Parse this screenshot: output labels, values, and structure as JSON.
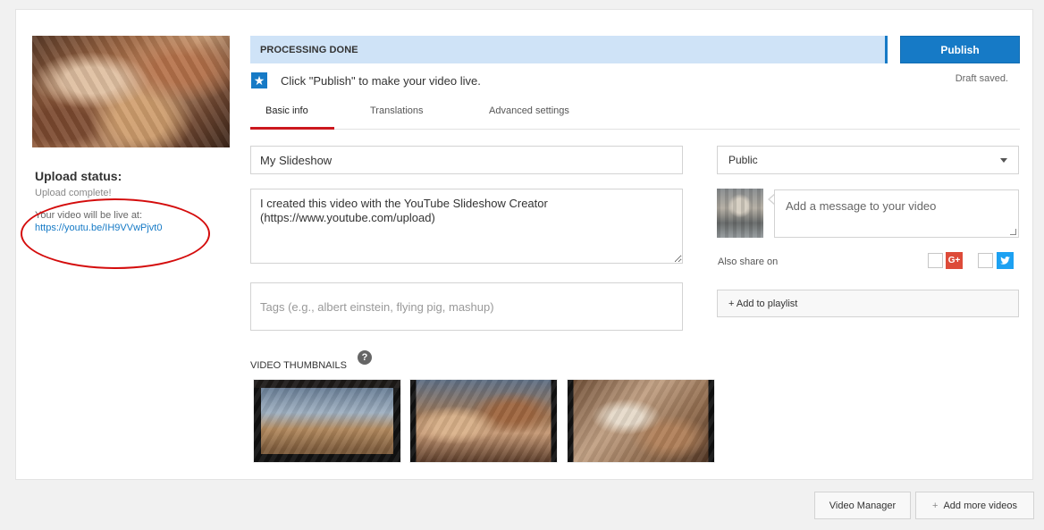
{
  "upload": {
    "status_title": "Upload status:",
    "complete_text": "Upload complete!",
    "live_at_text": "Your video will be live at:",
    "live_link": "https://youtu.be/IH9VVwPjvt0"
  },
  "processing": {
    "status_text": "PROCESSING DONE",
    "publish_label": "Publish",
    "draft_saved": "Draft saved.",
    "hint": "Click \"Publish\" to make your video live."
  },
  "tabs": [
    {
      "label": "Basic info",
      "active": true
    },
    {
      "label": "Translations",
      "active": false
    },
    {
      "label": "Advanced settings",
      "active": false
    }
  ],
  "form": {
    "title_value": "My Slideshow",
    "description_value": "I created this video with the YouTube Slideshow Creator\n(https://www.youtube.com/upload)",
    "tags_placeholder": "Tags (e.g., albert einstein, flying pig, mashup)",
    "privacy_selected": "Public",
    "message_placeholder": "Add a message to your video",
    "also_share_label": "Also share on",
    "gplus_glyph": "G+",
    "add_playlist_label": "+ Add to playlist"
  },
  "thumbnails": {
    "label": "VIDEO THUMBNAILS",
    "help_glyph": "?"
  },
  "footer": {
    "video_manager_label": "Video Manager",
    "add_more_label": "Add more videos"
  },
  "colors": {
    "accent_blue": "#167ac6",
    "processing_bar": "#cfe3f7",
    "tab_active_underline": "#cc181e",
    "annotation_ellipse": "#d40c0c",
    "gplus_red": "#dd4b39",
    "twitter_blue": "#1da1f2"
  },
  "icons": [
    "star-icon",
    "chevron-down-icon",
    "google-plus-icon",
    "twitter-icon",
    "help-icon",
    "plus-icon"
  ]
}
